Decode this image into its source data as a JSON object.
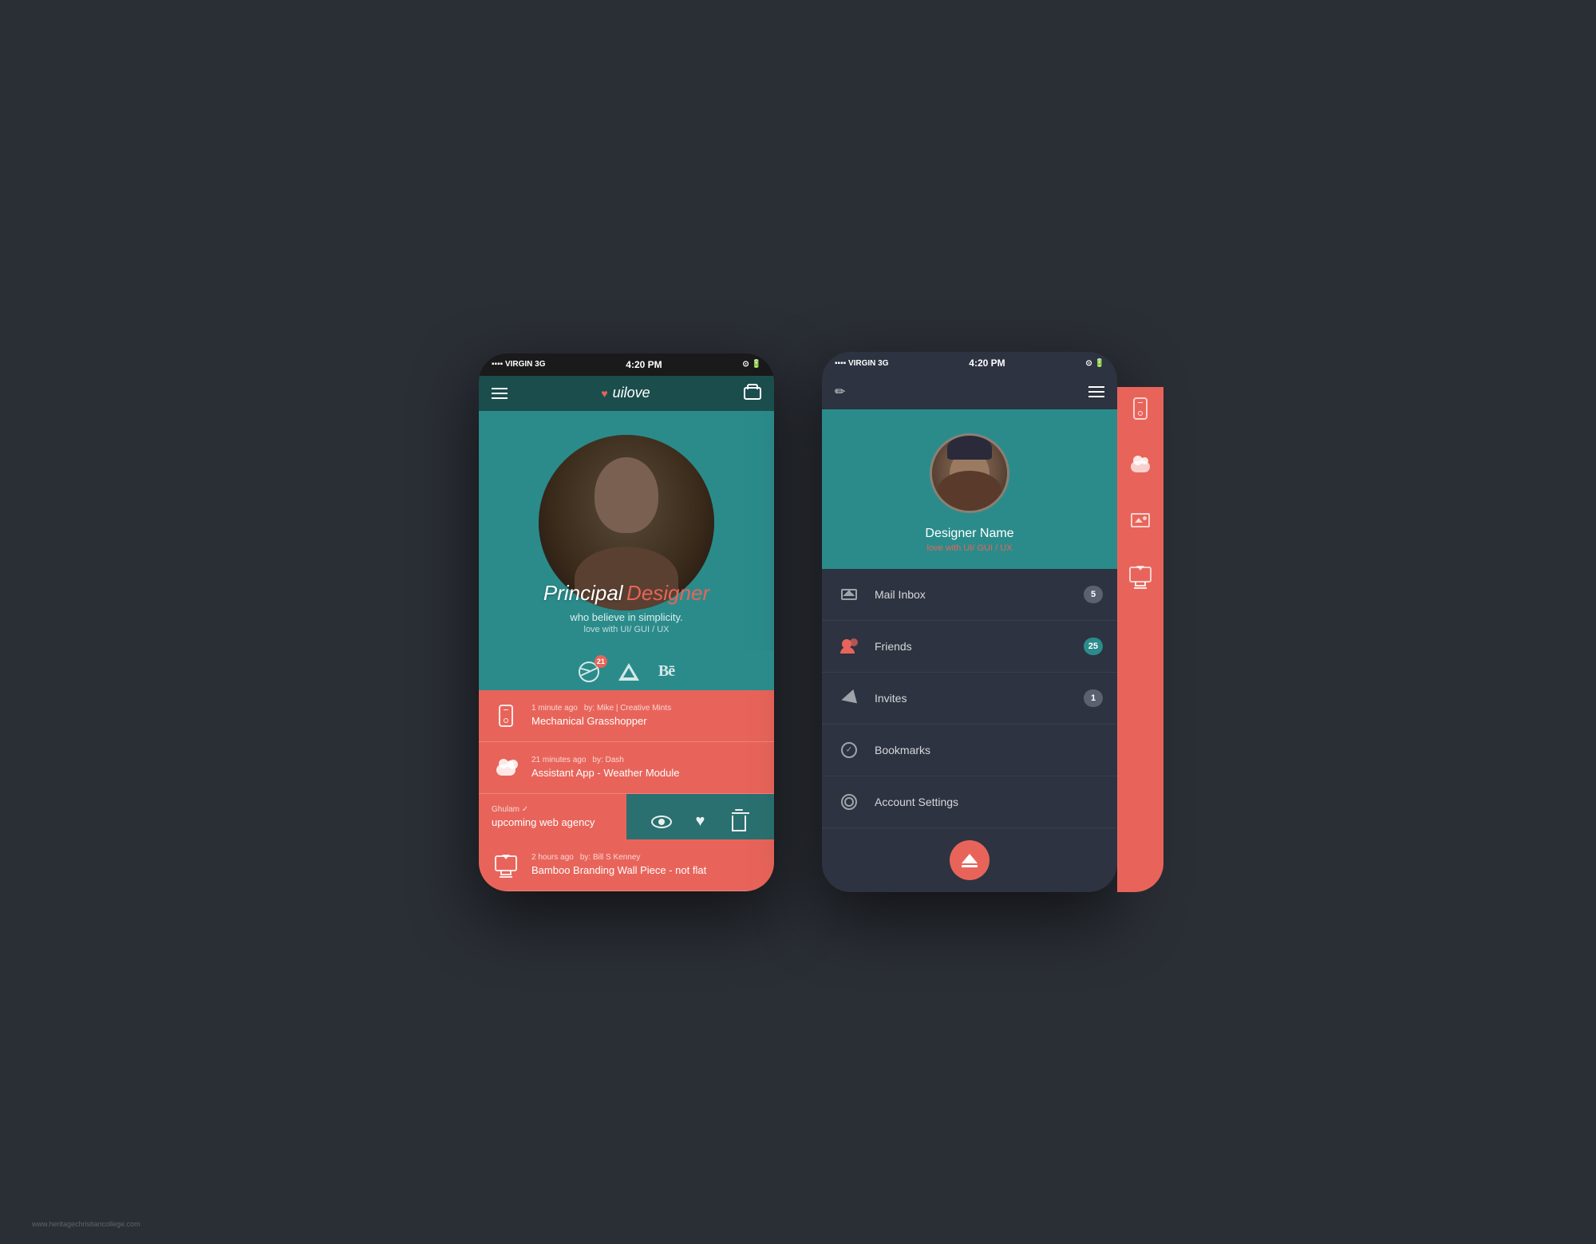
{
  "page": {
    "background": "#2a2e35",
    "watermark": "www.heritagechristiancollege.com"
  },
  "phone1": {
    "status_bar": {
      "signal": "▪▪▪▪ VIRGIN  3G",
      "time": "4:20 PM",
      "icons": "⊙ 🔋"
    },
    "topbar": {
      "logo": "uilove",
      "heart": "♥"
    },
    "hero": {
      "line1": "Principal",
      "line2": "Designer",
      "subtitle1": "who believe in simplicity.",
      "subtitle2": "love with UI/ GUI / UX"
    },
    "social": {
      "dribbble_badge": "21"
    },
    "feed": [
      {
        "time": "1 minute ago",
        "by": "by: Mike | Creative Mints",
        "title": "Mechanical Grasshopper",
        "icon": "phone"
      },
      {
        "time": "21 minutes ago",
        "by": "by: Dash",
        "title": "Assistant App - Weather Module",
        "icon": "cloud"
      },
      {
        "time": "",
        "by": "Ghulam ✓",
        "title": "upcoming web agency",
        "icon": ""
      },
      {
        "time": "2 hours ago",
        "by": "by: Bill S Kenney",
        "title": "Bamboo Branding  Wall Piece - not flat",
        "icon": "monitor"
      }
    ]
  },
  "phone2": {
    "status_bar": {
      "signal": "▪▪▪▪ VIRGIN  3G",
      "time": "4:20 PM",
      "icons": "⊙ 🔋"
    },
    "profile": {
      "name": "Designer Name",
      "subtitle": "love with UI/ GUI / UX"
    },
    "menu": [
      {
        "id": "mail-inbox",
        "label": "Mail Inbox",
        "badge": "5",
        "badge_type": "normal"
      },
      {
        "id": "friends",
        "label": "Friends",
        "badge": "25",
        "badge_type": "teal"
      },
      {
        "id": "invites",
        "label": "Invites",
        "badge": "1",
        "badge_type": "normal"
      },
      {
        "id": "bookmarks",
        "label": "Bookmarks",
        "badge": "",
        "badge_type": ""
      },
      {
        "id": "account-settings",
        "label": "Account Settings",
        "badge": "",
        "badge_type": ""
      }
    ]
  }
}
